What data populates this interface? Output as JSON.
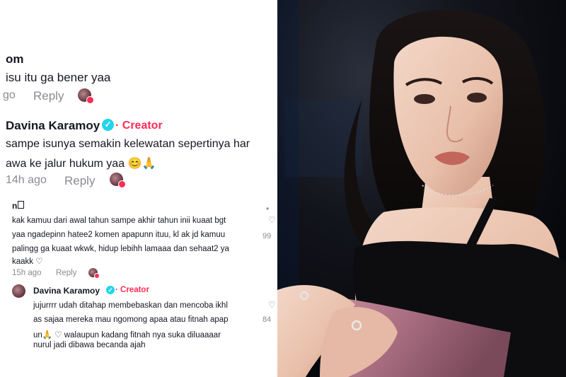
{
  "comment_top": {
    "author_fragment": "om",
    "text": "isu itu ga bener yaa",
    "time_fragment": "go",
    "reply": "Reply"
  },
  "reply1": {
    "author": "Davina Karamoy",
    "creator_label": "· Creator",
    "line1": "sampe isunya semakin kelewatan sepertinya har",
    "line2": "awa ke jalur hukum yaa 😊🙏",
    "time": "14h ago",
    "reply": "Reply"
  },
  "comment2": {
    "author": "n",
    "line1": "kak kamuu dari awal tahun sampe akhir tahun inii kuaat bgt",
    "line2": "yaa ngadepinn hatee2 komen apapunn ituu, kl ak jd kamuu",
    "line3": "palingg ga kuaat wkwk, hidup lebihh lamaaa dan sehaat2 ya",
    "line4": "kaakk ♡",
    "time": "15h ago",
    "reply": "Reply",
    "side_count": "99"
  },
  "reply2": {
    "author": "Davina Karamoy",
    "creator_label": "· Creator",
    "line1": "jujurrrr udah ditahap membebaskan dan mencoba ikhl",
    "line2": "as sajaa mereka mau ngomong apaa atau fitnah apap",
    "line3": "un🙏 ♡  walaupun kadang fitnah nya suka diluaaaar",
    "line4": "nurul jadi dibawa becanda ajah",
    "side_count": "84"
  },
  "colors": {
    "creator": "#fe2c55",
    "verified": "#20d5ec",
    "text": "#161823",
    "meta": "#8a8b91"
  }
}
